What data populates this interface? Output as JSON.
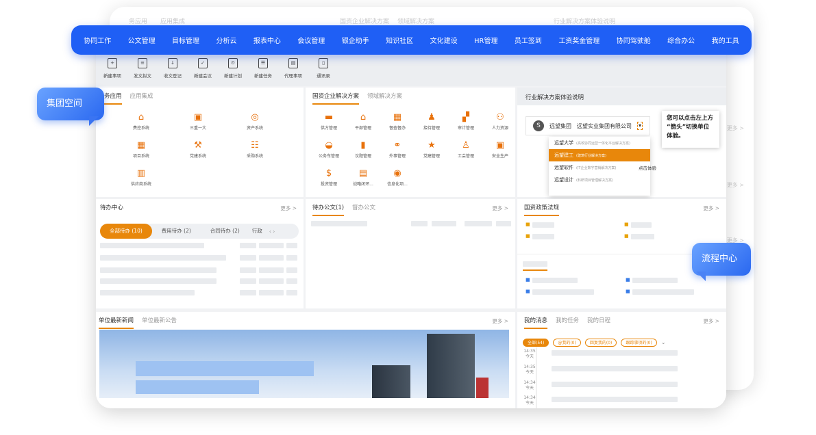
{
  "nav": [
    "协同工作",
    "公文管理",
    "目标管理",
    "分析云",
    "报表中心",
    "会议管理",
    "银企助手",
    "知识社区",
    "文化建设",
    "HR管理",
    "员工签到",
    "工资奖金管理",
    "协同驾驶舱",
    "综合办公",
    "我的工具"
  ],
  "back_headers": [
    "务应用",
    "应用集成",
    "国资企业解决方案",
    "领域解决方案",
    "行业解决方案体验说明"
  ],
  "back_more": "更多 >",
  "toolbar": [
    {
      "icon": "+",
      "label": "新建事项"
    },
    {
      "icon": "≡",
      "label": "发文拟文"
    },
    {
      "icon": "↓",
      "label": "收文登记"
    },
    {
      "icon": "✓",
      "label": "新建会议"
    },
    {
      "icon": "⏲",
      "label": "新建计划"
    },
    {
      "icon": "☰",
      "label": "新建任务"
    },
    {
      "icon": "▤",
      "label": "代理事项"
    },
    {
      "icon": "▯",
      "label": "通讯录"
    }
  ],
  "apps": {
    "tabs": [
      "务应用",
      "应用集成"
    ],
    "items": [
      {
        "icon": "⌂",
        "label": "费控系统"
      },
      {
        "icon": "▣",
        "label": "三重一大"
      },
      {
        "icon": "◎",
        "label": "资产系统"
      },
      {
        "icon": "▦",
        "label": "项目系统"
      },
      {
        "icon": "⚒",
        "label": "党建系统"
      },
      {
        "icon": "☷",
        "label": "采购系统"
      },
      {
        "icon": "▥",
        "label": "供应商系统"
      }
    ]
  },
  "soe": {
    "tabs": [
      "国资企业解决方案",
      "领域解决方案"
    ],
    "items": [
      {
        "icon": "▬",
        "label": "供方管理"
      },
      {
        "icon": "⌂",
        "label": "干部管理"
      },
      {
        "icon": "▦",
        "label": "督查督办"
      },
      {
        "icon": "♟",
        "label": "接待管理"
      },
      {
        "icon": "▞",
        "label": "审计管理"
      },
      {
        "icon": "⚇",
        "label": "人力资源"
      },
      {
        "icon": "◒",
        "label": "公务车管理"
      },
      {
        "icon": "▮",
        "label": "议题管理"
      },
      {
        "icon": "⚭",
        "label": "外事管理"
      },
      {
        "icon": "★",
        "label": "党建管理"
      },
      {
        "icon": "♙",
        "label": "工会管理"
      },
      {
        "icon": "▣",
        "label": "安全生产"
      },
      {
        "icon": "$",
        "label": "投资管理"
      },
      {
        "icon": "▤",
        "label": "战略闭环..."
      },
      {
        "icon": "◉",
        "label": "信息化项..."
      }
    ]
  },
  "industry": {
    "title": "行业解决方案体验说明",
    "brand_logo": "S",
    "brand_name": "远望集团",
    "company": "远望实业集团有限公司",
    "arrow": "▾",
    "dropdown": [
      {
        "name": "远望大学",
        "desc": "(高校协同运营一体化平台解决方案)"
      },
      {
        "name": "远望建工",
        "desc": "(建筑行业解决方案)"
      },
      {
        "name": "远望软件",
        "desc": "(IT企业数字营销解决方案)"
      },
      {
        "name": "远望设计",
        "desc": "(科研项目管理解决方案)"
      }
    ],
    "click_hint": "点击体验",
    "callout_line1": "您可以点击左上方",
    "callout_line2": "“箭头”切换单位",
    "callout_line3": "体验。"
  },
  "todo": {
    "title": "待办中心",
    "more": "更多 >",
    "pills": [
      "全部待办 (10)",
      "费用待办 (2)",
      "合同待办 (2)",
      "行政"
    ],
    "arrows": "‹ ›"
  },
  "docs": {
    "tabs": [
      "待办公文(1)",
      "督办公文"
    ],
    "more": "更多 >"
  },
  "policy": {
    "title": "国资政策法规",
    "more": "更多 >"
  },
  "news": {
    "tabs": [
      "单位最新新闻",
      "单位最新公告"
    ],
    "more": "更多 >"
  },
  "msgs": {
    "tabs": [
      "我的消息",
      "我的任务",
      "我的日程"
    ],
    "more": "更多 >",
    "tags": [
      "全部(54)",
      "@我的(0)",
      "回复我的(0)",
      "跟踪事项的(0)"
    ],
    "dropdown": "⌄",
    "times": [
      {
        "t": "14:35",
        "d": "今天"
      },
      {
        "t": "14:35",
        "d": "今天"
      },
      {
        "t": "14:34",
        "d": "今天"
      },
      {
        "t": "14:34",
        "d": "今天"
      }
    ]
  },
  "bubbles": {
    "group": "集团空间",
    "flow": "流程中心"
  }
}
